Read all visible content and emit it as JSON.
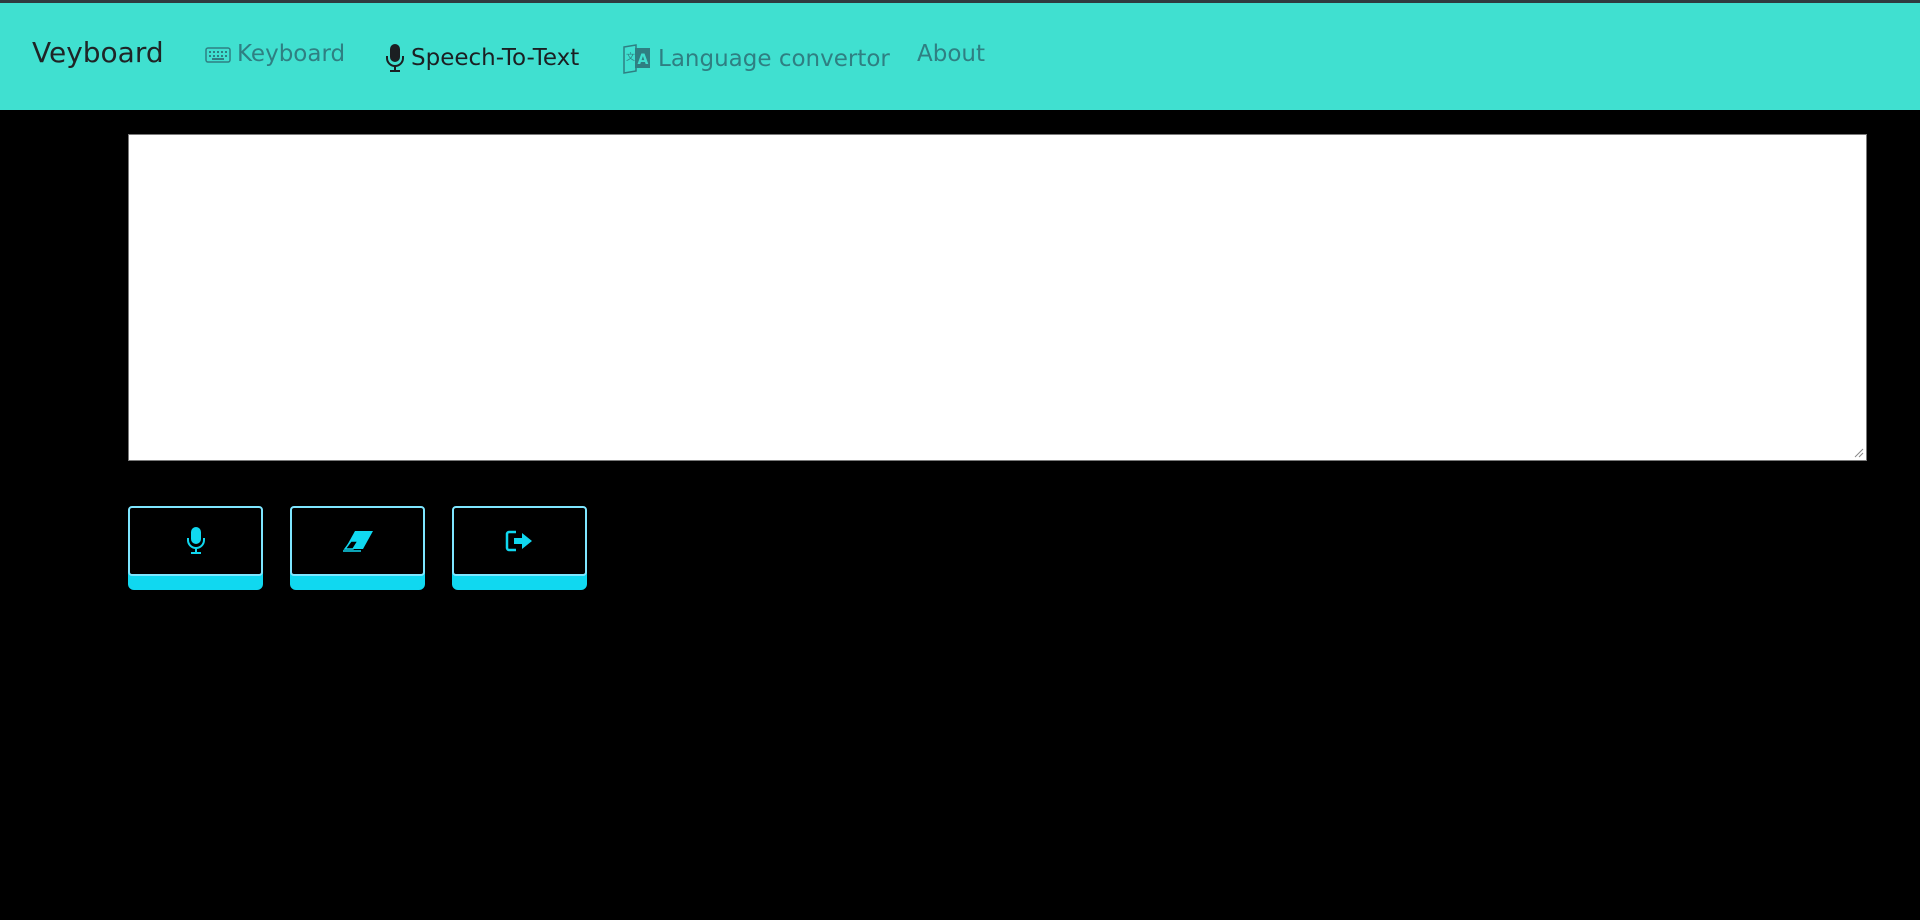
{
  "navbar": {
    "brand": "Veyboard",
    "items": [
      {
        "label": "Keyboard",
        "icon": "keyboard-icon",
        "active": false
      },
      {
        "label": "Speech-To-Text",
        "icon": "microphone-icon",
        "active": true
      },
      {
        "label": "Language convertor",
        "icon": "translate-icon",
        "active": false
      },
      {
        "label": "About",
        "icon": "",
        "active": false
      }
    ]
  },
  "editor": {
    "value": "",
    "placeholder": ""
  },
  "controls": [
    {
      "name": "start-dictation",
      "icon": "microphone-icon"
    },
    {
      "name": "clear-text",
      "icon": "eraser-icon"
    },
    {
      "name": "export-text",
      "icon": "sign-out-icon"
    }
  ],
  "colors": {
    "navbar_bg": "#40e0d0",
    "page_bg": "#000000",
    "accent": "#10d8f0",
    "nav_text": "#2f7f82",
    "nav_text_active": "#1b1f22"
  }
}
